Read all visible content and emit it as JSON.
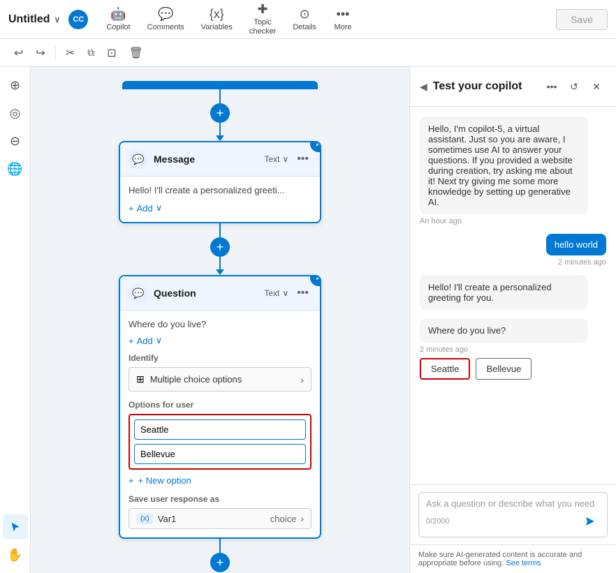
{
  "title": "Untitled",
  "title_chevron": "∨",
  "avatar": "CC",
  "toolbar": {
    "copilot_label": "Copilot",
    "comments_label": "Comments",
    "variables_label": "Variables",
    "topic_checker_label": "Topic checker",
    "details_label": "Details",
    "more_label": "More",
    "save_label": "Save"
  },
  "toolbar2": {
    "undo_label": "↩",
    "redo_label": "↪",
    "cut_label": "✂",
    "copy_label": "⧉",
    "duplicate_label": "⊡",
    "delete_label": "🗑"
  },
  "canvas": {
    "message_card": {
      "title": "Message",
      "type": "Text",
      "body": "Hello! I'll create a personalized greeti...",
      "add_label": "+ Add"
    },
    "question_card": {
      "title": "Question",
      "type": "Text",
      "question": "Where do you live?",
      "add_label": "+ Add",
      "identify_label": "Identify",
      "identify_option": "Multiple choice options",
      "options_label": "Options for user",
      "option1": "Seattle",
      "option2": "Bellevue",
      "new_option_label": "+ New option",
      "save_response_label": "Save user response as",
      "var_tag": "(x)",
      "var_name": "Var1",
      "var_choice": "choice"
    }
  },
  "left_tools": [
    {
      "name": "zoom-in",
      "icon": "⊕"
    },
    {
      "name": "target",
      "icon": "◎"
    },
    {
      "name": "zoom-out",
      "icon": "⊖"
    },
    {
      "name": "globe",
      "icon": "🌐"
    },
    {
      "name": "cursor",
      "icon": "↖"
    },
    {
      "name": "hand",
      "icon": "✋"
    }
  ],
  "copilot_panel": {
    "title": "Test your copilot",
    "expand_icon": "◀",
    "more_icon": "•••",
    "refresh_icon": "↺",
    "close_icon": "✕",
    "messages": [
      {
        "type": "bot",
        "text": "Hello, I'm copilot-5, a virtual assistant. Just so you are aware, I sometimes use AI to answer your questions. If you provided a website during creation, try asking me about it! Next try giving me some more knowledge by setting up generative AI.",
        "time": "An hour ago"
      },
      {
        "type": "user",
        "text": "hello world",
        "time": "2 minutes ago"
      },
      {
        "type": "bot",
        "text": "Hello! I'll create a personalized greeting for you.",
        "time": ""
      },
      {
        "type": "bot",
        "text": "Where do you live?",
        "time": "2 minutes ago",
        "choices": [
          "Seattle",
          "Bellevue"
        ]
      }
    ],
    "input_placeholder": "Ask a question or describe what you need",
    "char_count": "0/2000",
    "footer": "Make sure AI-generated content is accurate and appropriate before using.",
    "footer_link": "See terms"
  }
}
